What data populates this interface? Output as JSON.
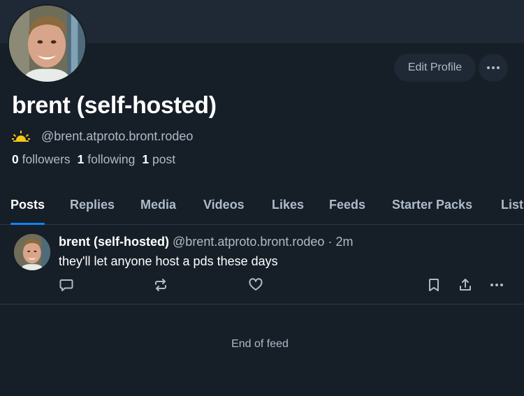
{
  "profile": {
    "display_name": "brent (self-hosted)",
    "handle": "@brent.atproto.bront.rodeo",
    "edit_label": "Edit Profile",
    "followers_count": "0",
    "followers_label": "followers",
    "following_count": "1",
    "following_label": "following",
    "posts_count": "1",
    "posts_label": "post"
  },
  "tabs": [
    {
      "label": "Posts",
      "active": true
    },
    {
      "label": "Replies"
    },
    {
      "label": "Media"
    },
    {
      "label": "Videos"
    },
    {
      "label": "Likes"
    },
    {
      "label": "Feeds"
    },
    {
      "label": "Starter Packs"
    },
    {
      "label": "List"
    }
  ],
  "feed": {
    "posts": [
      {
        "author": "brent (self-hosted)",
        "handle": "@brent.atproto.bront.rodeo",
        "time": "2m",
        "separator": "·",
        "text": "they'll let anyone host a pds these days"
      }
    ],
    "end_label": "End of feed"
  },
  "icons": {
    "badge": "sunrise-icon",
    "more": "more-dots-icon",
    "reply": "reply-bubble-icon",
    "repost": "repost-icon",
    "like": "heart-icon",
    "bookmark": "bookmark-icon",
    "share": "share-icon",
    "post_more": "more-dots-icon"
  },
  "colors": {
    "background": "#161e27",
    "banner": "#1e2935",
    "accent": "#1083fe",
    "muted_text": "#aebbc9",
    "badge": "#f5c518",
    "divider": "#2e3a48"
  }
}
